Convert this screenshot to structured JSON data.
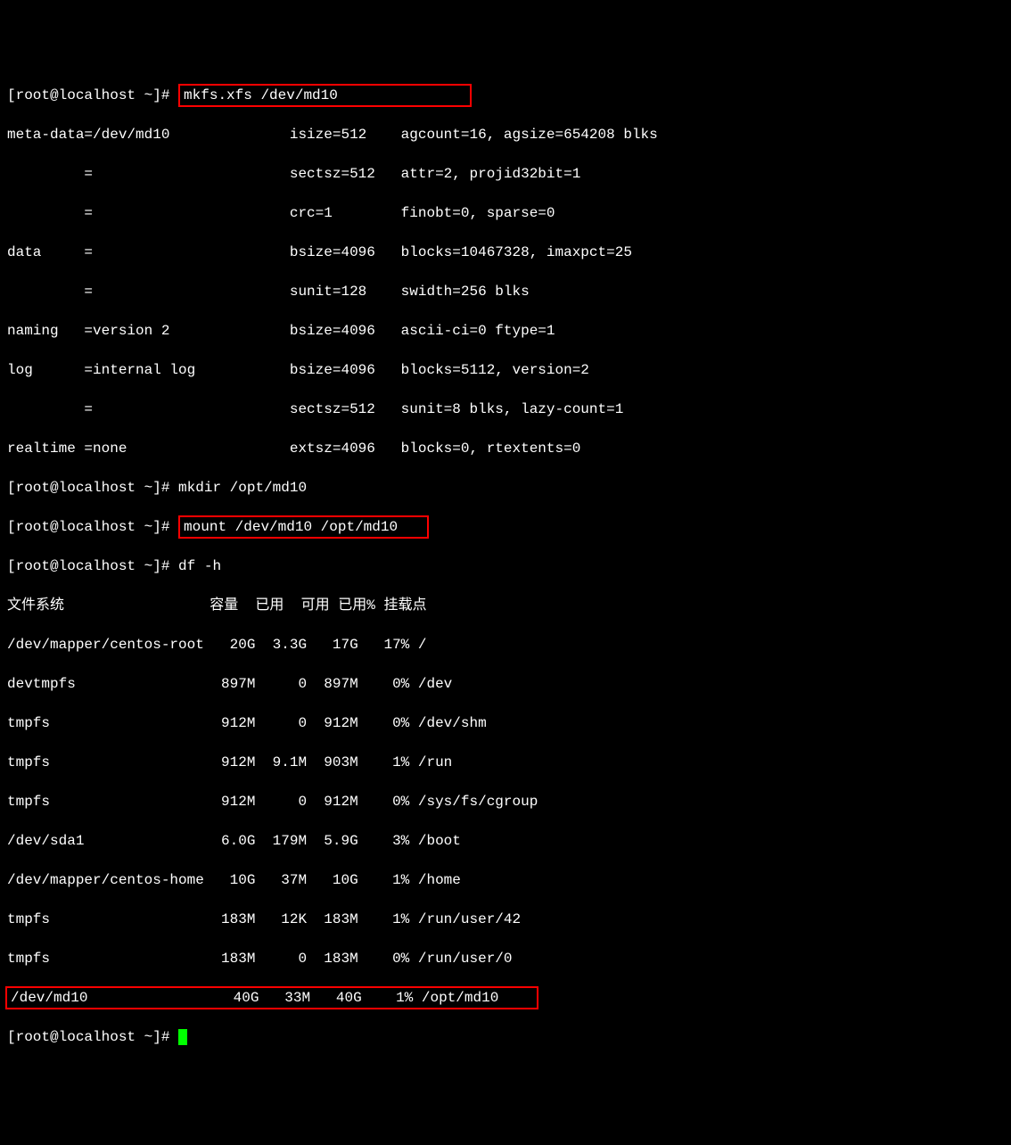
{
  "prompt1_prefix": "[root@localhost ~]# ",
  "cmd1": "mkfs.xfs /dev/md10               ",
  "mkfs_lines": [
    "meta-data=/dev/md10              isize=512    agcount=16, agsize=654208 blks",
    "         =                       sectsz=512   attr=2, projid32bit=1",
    "         =                       crc=1        finobt=0, sparse=0",
    "data     =                       bsize=4096   blocks=10467328, imaxpct=25",
    "         =                       sunit=128    swidth=256 blks",
    "naming   =version 2              bsize=4096   ascii-ci=0 ftype=1",
    "log      =internal log           bsize=4096   blocks=5112, version=2",
    "         =                       sectsz=512   sunit=8 blks, lazy-count=1",
    "realtime =none                   extsz=4096   blocks=0, rtextents=0"
  ],
  "prompt2_prefix": "[root@localhost ~]# ",
  "cmd2": "mkdir /opt/md10",
  "prompt3_prefix": "[root@localhost ~]# ",
  "cmd3": "mount /dev/md10 /opt/md10   ",
  "prompt4_prefix": "[root@localhost ~]# ",
  "cmd4": "df -h",
  "df_header": "文件系统                 容量  已用  可用 已用% 挂载点",
  "df_rows": [
    "/dev/mapper/centos-root   20G  3.3G   17G   17% /",
    "devtmpfs                 897M     0  897M    0% /dev",
    "tmpfs                    912M     0  912M    0% /dev/shm",
    "tmpfs                    912M  9.1M  903M    1% /run",
    "tmpfs                    912M     0  912M    0% /sys/fs/cgroup",
    "/dev/sda1                6.0G  179M  5.9G    3% /boot",
    "/dev/mapper/centos-home   10G   37M   10G    1% /home",
    "tmpfs                    183M   12K  183M    1% /run/user/42",
    "tmpfs                    183M     0  183M    0% /run/user/0"
  ],
  "df_highlight": "/dev/md10                 40G   33M   40G    1% /opt/md10    ",
  "prompt5_prefix": "[root@localhost ~]# ",
  "chart_data": {
    "type": "table",
    "title": "df -h output",
    "columns": [
      "文件系统",
      "容量",
      "已用",
      "可用",
      "已用%",
      "挂载点"
    ],
    "rows": [
      [
        "/dev/mapper/centos-root",
        "20G",
        "3.3G",
        "17G",
        "17%",
        "/"
      ],
      [
        "devtmpfs",
        "897M",
        "0",
        "897M",
        "0%",
        "/dev"
      ],
      [
        "tmpfs",
        "912M",
        "0",
        "912M",
        "0%",
        "/dev/shm"
      ],
      [
        "tmpfs",
        "912M",
        "9.1M",
        "903M",
        "1%",
        "/run"
      ],
      [
        "tmpfs",
        "912M",
        "0",
        "912M",
        "0%",
        "/sys/fs/cgroup"
      ],
      [
        "/dev/sda1",
        "6.0G",
        "179M",
        "5.9G",
        "3%",
        "/boot"
      ],
      [
        "/dev/mapper/centos-home",
        "10G",
        "37M",
        "10G",
        "1%",
        "/home"
      ],
      [
        "tmpfs",
        "183M",
        "12K",
        "183M",
        "1%",
        "/run/user/42"
      ],
      [
        "tmpfs",
        "183M",
        "0",
        "183M",
        "0%",
        "/run/user/0"
      ],
      [
        "/dev/md10",
        "40G",
        "33M",
        "40G",
        "1%",
        "/opt/md10"
      ]
    ]
  }
}
